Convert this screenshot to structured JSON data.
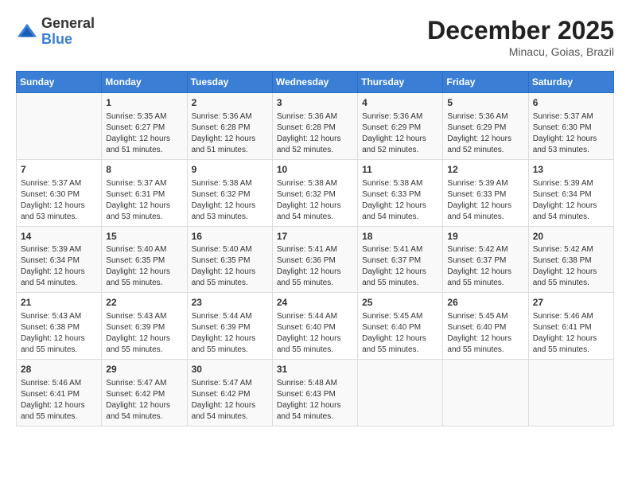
{
  "header": {
    "logo_general": "General",
    "logo_blue": "Blue",
    "month_title": "December 2025",
    "location": "Minacu, Goias, Brazil"
  },
  "days_of_week": [
    "Sunday",
    "Monday",
    "Tuesday",
    "Wednesday",
    "Thursday",
    "Friday",
    "Saturday"
  ],
  "weeks": [
    [
      {
        "day": "",
        "info": ""
      },
      {
        "day": "1",
        "info": "Sunrise: 5:35 AM\nSunset: 6:27 PM\nDaylight: 12 hours\nand 51 minutes."
      },
      {
        "day": "2",
        "info": "Sunrise: 5:36 AM\nSunset: 6:28 PM\nDaylight: 12 hours\nand 51 minutes."
      },
      {
        "day": "3",
        "info": "Sunrise: 5:36 AM\nSunset: 6:28 PM\nDaylight: 12 hours\nand 52 minutes."
      },
      {
        "day": "4",
        "info": "Sunrise: 5:36 AM\nSunset: 6:29 PM\nDaylight: 12 hours\nand 52 minutes."
      },
      {
        "day": "5",
        "info": "Sunrise: 5:36 AM\nSunset: 6:29 PM\nDaylight: 12 hours\nand 52 minutes."
      },
      {
        "day": "6",
        "info": "Sunrise: 5:37 AM\nSunset: 6:30 PM\nDaylight: 12 hours\nand 53 minutes."
      }
    ],
    [
      {
        "day": "7",
        "info": "Sunrise: 5:37 AM\nSunset: 6:30 PM\nDaylight: 12 hours\nand 53 minutes."
      },
      {
        "day": "8",
        "info": "Sunrise: 5:37 AM\nSunset: 6:31 PM\nDaylight: 12 hours\nand 53 minutes."
      },
      {
        "day": "9",
        "info": "Sunrise: 5:38 AM\nSunset: 6:32 PM\nDaylight: 12 hours\nand 53 minutes."
      },
      {
        "day": "10",
        "info": "Sunrise: 5:38 AM\nSunset: 6:32 PM\nDaylight: 12 hours\nand 54 minutes."
      },
      {
        "day": "11",
        "info": "Sunrise: 5:38 AM\nSunset: 6:33 PM\nDaylight: 12 hours\nand 54 minutes."
      },
      {
        "day": "12",
        "info": "Sunrise: 5:39 AM\nSunset: 6:33 PM\nDaylight: 12 hours\nand 54 minutes."
      },
      {
        "day": "13",
        "info": "Sunrise: 5:39 AM\nSunset: 6:34 PM\nDaylight: 12 hours\nand 54 minutes."
      }
    ],
    [
      {
        "day": "14",
        "info": "Sunrise: 5:39 AM\nSunset: 6:34 PM\nDaylight: 12 hours\nand 54 minutes."
      },
      {
        "day": "15",
        "info": "Sunrise: 5:40 AM\nSunset: 6:35 PM\nDaylight: 12 hours\nand 55 minutes."
      },
      {
        "day": "16",
        "info": "Sunrise: 5:40 AM\nSunset: 6:35 PM\nDaylight: 12 hours\nand 55 minutes."
      },
      {
        "day": "17",
        "info": "Sunrise: 5:41 AM\nSunset: 6:36 PM\nDaylight: 12 hours\nand 55 minutes."
      },
      {
        "day": "18",
        "info": "Sunrise: 5:41 AM\nSunset: 6:37 PM\nDaylight: 12 hours\nand 55 minutes."
      },
      {
        "day": "19",
        "info": "Sunrise: 5:42 AM\nSunset: 6:37 PM\nDaylight: 12 hours\nand 55 minutes."
      },
      {
        "day": "20",
        "info": "Sunrise: 5:42 AM\nSunset: 6:38 PM\nDaylight: 12 hours\nand 55 minutes."
      }
    ],
    [
      {
        "day": "21",
        "info": "Sunrise: 5:43 AM\nSunset: 6:38 PM\nDaylight: 12 hours\nand 55 minutes."
      },
      {
        "day": "22",
        "info": "Sunrise: 5:43 AM\nSunset: 6:39 PM\nDaylight: 12 hours\nand 55 minutes."
      },
      {
        "day": "23",
        "info": "Sunrise: 5:44 AM\nSunset: 6:39 PM\nDaylight: 12 hours\nand 55 minutes."
      },
      {
        "day": "24",
        "info": "Sunrise: 5:44 AM\nSunset: 6:40 PM\nDaylight: 12 hours\nand 55 minutes."
      },
      {
        "day": "25",
        "info": "Sunrise: 5:45 AM\nSunset: 6:40 PM\nDaylight: 12 hours\nand 55 minutes."
      },
      {
        "day": "26",
        "info": "Sunrise: 5:45 AM\nSunset: 6:40 PM\nDaylight: 12 hours\nand 55 minutes."
      },
      {
        "day": "27",
        "info": "Sunrise: 5:46 AM\nSunset: 6:41 PM\nDaylight: 12 hours\nand 55 minutes."
      }
    ],
    [
      {
        "day": "28",
        "info": "Sunrise: 5:46 AM\nSunset: 6:41 PM\nDaylight: 12 hours\nand 55 minutes."
      },
      {
        "day": "29",
        "info": "Sunrise: 5:47 AM\nSunset: 6:42 PM\nDaylight: 12 hours\nand 54 minutes."
      },
      {
        "day": "30",
        "info": "Sunrise: 5:47 AM\nSunset: 6:42 PM\nDaylight: 12 hours\nand 54 minutes."
      },
      {
        "day": "31",
        "info": "Sunrise: 5:48 AM\nSunset: 6:43 PM\nDaylight: 12 hours\nand 54 minutes."
      },
      {
        "day": "",
        "info": ""
      },
      {
        "day": "",
        "info": ""
      },
      {
        "day": "",
        "info": ""
      }
    ]
  ]
}
